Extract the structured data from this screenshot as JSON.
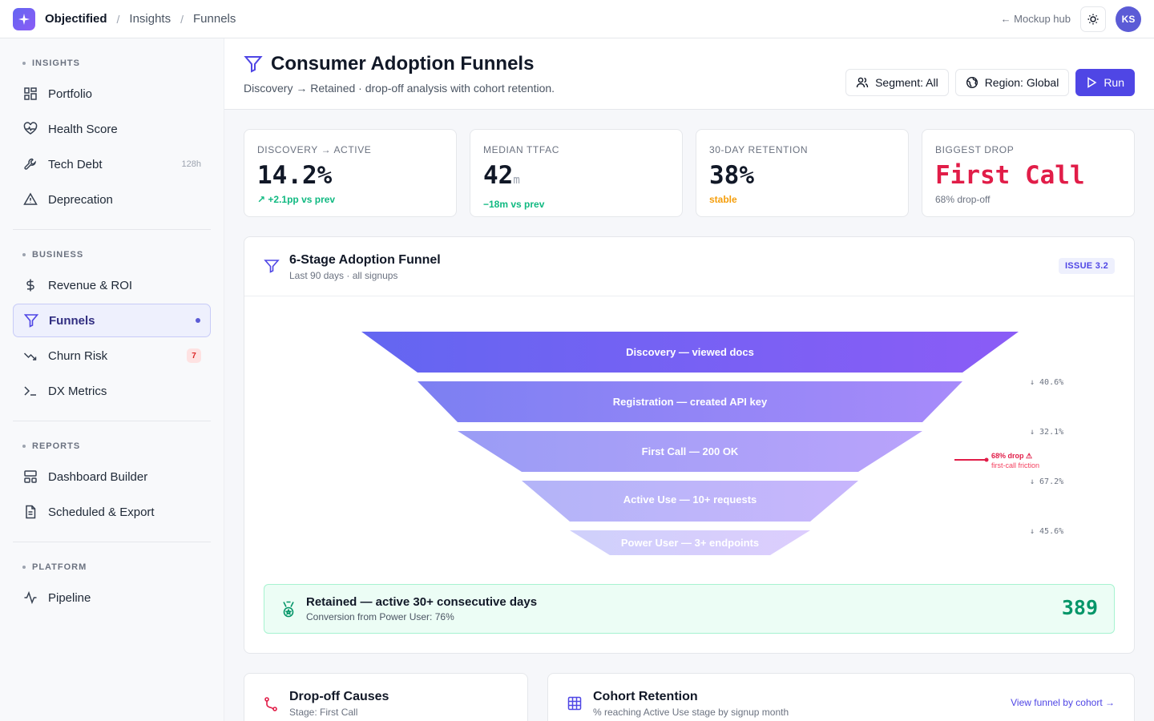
{
  "topbar": {
    "brand": "Objectified",
    "breadcrumbs": [
      "Insights",
      "Funnels"
    ],
    "hub_link": "← Mockup hub",
    "avatar_initials": "KS"
  },
  "sidebar": {
    "sections": [
      {
        "title": "INSIGHTS",
        "items": [
          {
            "label": "Portfolio",
            "icon": "grid-icon"
          },
          {
            "label": "Health Score",
            "icon": "heart-pulse-icon"
          },
          {
            "label": "Tech Debt",
            "icon": "wrench-icon",
            "meta": "128h"
          },
          {
            "label": "Deprecation",
            "icon": "warning-triangle-icon"
          }
        ]
      },
      {
        "title": "BUSINESS",
        "items": [
          {
            "label": "Revenue & ROI",
            "icon": "dollar-icon"
          },
          {
            "label": "Funnels",
            "icon": "funnel-icon",
            "active": true
          },
          {
            "label": "Churn Risk",
            "icon": "trend-down-icon",
            "badge": "7"
          },
          {
            "label": "DX Metrics",
            "icon": "terminal-icon"
          }
        ]
      },
      {
        "title": "REPORTS",
        "items": [
          {
            "label": "Dashboard Builder",
            "icon": "layout-icon"
          },
          {
            "label": "Scheduled & Export",
            "icon": "file-icon"
          }
        ]
      },
      {
        "title": "PLATFORM",
        "items": [
          {
            "label": "Pipeline",
            "icon": "activity-icon"
          }
        ]
      }
    ]
  },
  "header": {
    "title": "Consumer Adoption Funnels",
    "subtitle": "Discovery → Retained · drop-off analysis with cohort retention.",
    "segment_label": "Segment: All",
    "region_label": "Region: Global",
    "run_label": "Run"
  },
  "kpis": [
    {
      "label": "DISCOVERY → ACTIVE",
      "value": "14.2%",
      "unit": "",
      "delta": "↗ +2.1pp vs prev",
      "delta_color": "#10b981"
    },
    {
      "label": "MEDIAN TTFAC",
      "value": "42",
      "unit": "m",
      "delta": "−18m vs prev",
      "delta_color": "#10b981"
    },
    {
      "label": "30-DAY RETENTION",
      "value": "38%",
      "unit": "",
      "delta": "stable",
      "delta_color": "#f59e0b"
    },
    {
      "label": "BIGGEST DROP",
      "value": "First Call",
      "unit": "",
      "delta": "68% drop-off",
      "delta_color": "#6b7280",
      "value_color": "#e11d48"
    }
  ],
  "funnel": {
    "title": "6-Stage Adoption Funnel",
    "subtitle": "Last 90 days · all signups",
    "issue": "ISSUE 3.2",
    "stages": [
      {
        "label": "Discovery — viewed docs"
      },
      {
        "label": "Registration — created API key"
      },
      {
        "label": "First Call — 200 OK"
      },
      {
        "label": "Active Use — 10+ requests"
      },
      {
        "label": "Power User — 3+ endpoints"
      }
    ],
    "conversions": [
      "↓ 40.6%",
      "↓ 32.1%",
      "↓ 67.2%",
      "↓ 45.6%"
    ],
    "drop_callout": {
      "title": "68% drop ⚠",
      "subtitle": "first-call friction"
    },
    "retained": {
      "title": "Retained — active 30+ consecutive days",
      "subtitle": "Conversion from Power User: 76%",
      "value": "389"
    }
  },
  "bottom": {
    "dropoff": {
      "title": "Drop-off Causes",
      "subtitle": "Stage: First Call"
    },
    "cohort": {
      "title": "Cohort Retention",
      "subtitle": "% reaching Active Use stage by signup month",
      "link": "View funnel by cohort →"
    }
  },
  "colors": {
    "accent": "#4f46e5",
    "danger": "#e11d48",
    "success": "#059669"
  }
}
